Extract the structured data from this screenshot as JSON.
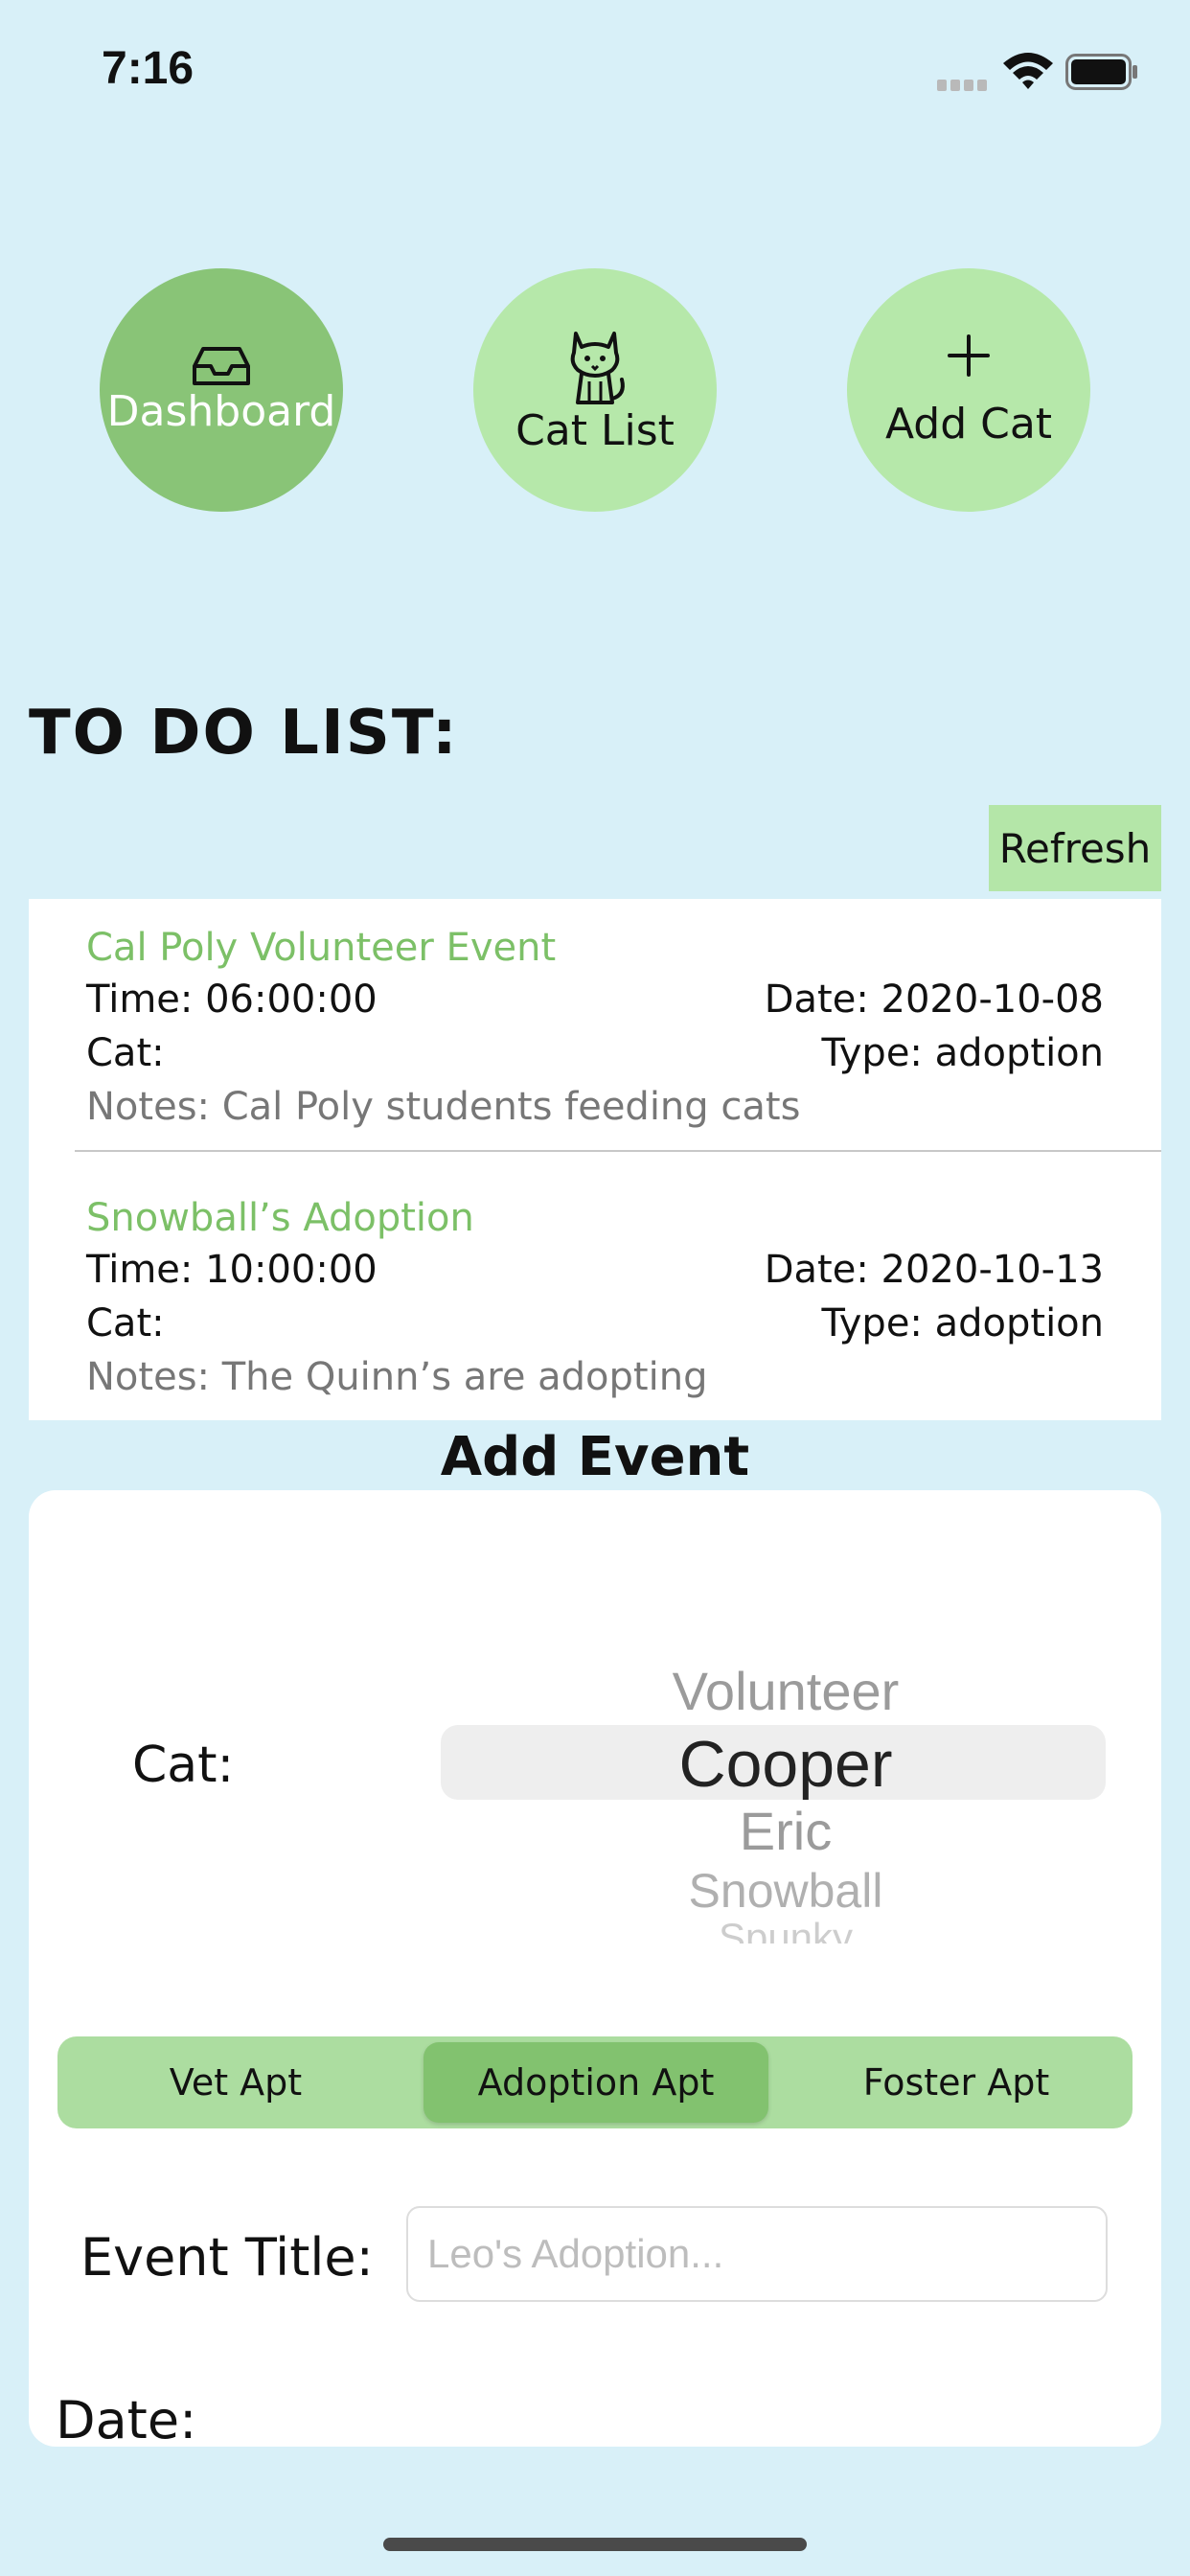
{
  "status_bar": {
    "time": "7:16"
  },
  "nav": {
    "dashboard": {
      "label": "Dashboard",
      "icon": "inbox-icon"
    },
    "cat_list": {
      "label": "Cat List",
      "icon": "cat-icon"
    },
    "add_cat": {
      "label": "Add Cat",
      "icon": "plus-icon"
    }
  },
  "todo": {
    "heading": "TO DO LIST:",
    "refresh_label": "Refresh",
    "items": [
      {
        "title": "Cal Poly Volunteer Event",
        "time": "Time: 06:00:00",
        "date": "Date: 2020-10-08",
        "cat": "Cat:",
        "type": "Type: adoption",
        "notes": "Notes: Cal Poly students feeding cats"
      },
      {
        "title": "Snowball’s Adoption",
        "time": "Time: 10:00:00",
        "date": "Date: 2020-10-13",
        "cat": "Cat:",
        "type": "Type: adoption",
        "notes": "Notes: The Quinn’s are adopting"
      }
    ]
  },
  "add_event": {
    "heading": "Add Event",
    "cat_label": "Cat:",
    "cat_picker": {
      "options": [
        "Volunteer",
        "Cooper",
        "Eric",
        "Snowball",
        "Spunky"
      ],
      "selected": "Cooper"
    },
    "appointment_types": [
      "Vet Apt",
      "Adoption Apt",
      "Foster Apt"
    ],
    "selected_appointment": "Adoption Apt",
    "event_title_label": "Event Title:",
    "event_title_value": "",
    "event_title_placeholder": "Leo's Adoption...",
    "date_label": "Date:"
  },
  "colors": {
    "background": "#d8f0f8",
    "accent_dark_green": "#89c477",
    "accent_light_green": "#b6e8aa",
    "title_green": "#7cc067"
  }
}
